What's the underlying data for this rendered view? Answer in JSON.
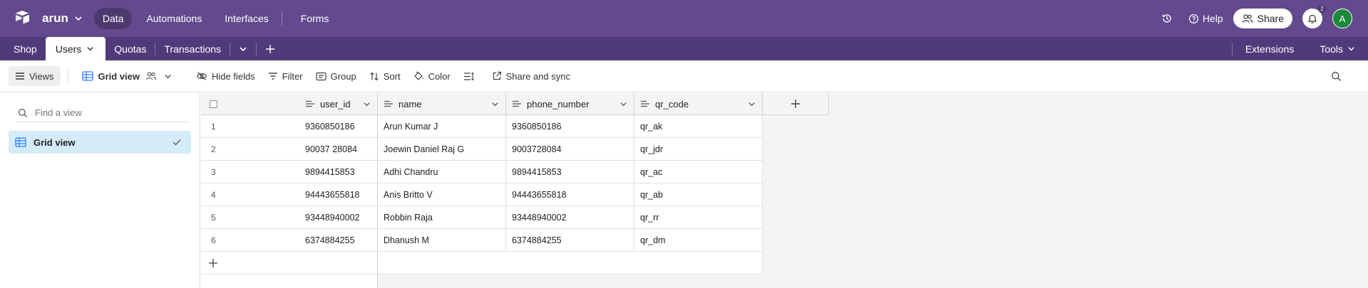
{
  "header": {
    "base_name": "arun",
    "nav": [
      "Data",
      "Automations",
      "Interfaces",
      "Forms"
    ],
    "help_label": "Help",
    "share_label": "Share",
    "notification_count": "2",
    "avatar_initial": "A"
  },
  "tables": {
    "tabs": [
      "Shop",
      "Users",
      "Quotas",
      "Transactions"
    ],
    "active": "Users",
    "extensions_label": "Extensions",
    "tools_label": "Tools"
  },
  "toolbar": {
    "views_label": "Views",
    "view_name": "Grid view",
    "hide_fields_label": "Hide fields",
    "filter_label": "Filter",
    "group_label": "Group",
    "sort_label": "Sort",
    "color_label": "Color",
    "share_sync_label": "Share and sync"
  },
  "sidebar": {
    "find_placeholder": "Find a view",
    "views": [
      "Grid view"
    ]
  },
  "grid": {
    "columns": [
      "user_id",
      "name",
      "phone_number",
      "qr_code"
    ],
    "rows": [
      {
        "n": "1",
        "user_id": "9360850186",
        "name": "Arun Kumar J",
        "phone_number": "9360850186",
        "qr_code": "qr_ak"
      },
      {
        "n": "2",
        "user_id": "90037 28084",
        "name": "Joewin Daniel Raj G",
        "phone_number": "9003728084",
        "qr_code": "qr_jdr"
      },
      {
        "n": "3",
        "user_id": "9894415853",
        "name": "Adhi Chandru",
        "phone_number": "9894415853",
        "qr_code": "qr_ac"
      },
      {
        "n": "4",
        "user_id": "94443655818",
        "name": "Anis Britto V",
        "phone_number": "94443655818",
        "qr_code": "qr_ab"
      },
      {
        "n": "5",
        "user_id": "93448940002",
        "name": "Robbin Raja",
        "phone_number": "93448940002",
        "qr_code": "qr_rr"
      },
      {
        "n": "6",
        "user_id": "6374884255",
        "name": "Dhanush M",
        "phone_number": "6374884255",
        "qr_code": "qr_dm"
      }
    ]
  },
  "colors": {
    "header_bg": "#63498d",
    "tabbar_bg": "#513a7a",
    "selected_view_bg": "#d3ecf7",
    "avatar_bg": "#1b8a3a"
  }
}
